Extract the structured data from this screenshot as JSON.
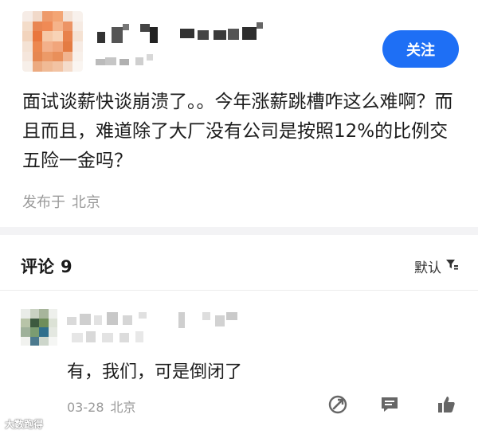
{
  "post": {
    "follow_label": "关注",
    "content": "面试谈薪快谈崩溃了。。今年涨薪跳槽咋这么难啊？而且而且，难道除了大厂没有公司是按照12%的比例交五险一金吗？",
    "location_prefix": "发布于",
    "location": "北京"
  },
  "comments": {
    "title": "评论",
    "count": "9",
    "sort_label": "默认",
    "items": [
      {
        "text": "有，我们，可是倒闭了",
        "date": "03-28",
        "location": "北京"
      }
    ]
  },
  "watermark": "大数跑得",
  "icons": [
    "filter-icon",
    "share-icon",
    "comment-icon",
    "like-icon"
  ],
  "colors": {
    "accent": "#1e6ff5",
    "secondary_text": "#9a9a9a"
  }
}
